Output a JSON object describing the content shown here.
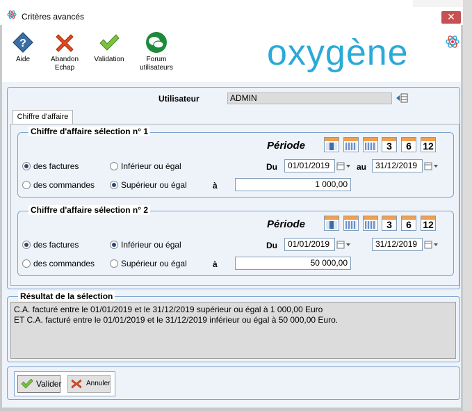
{
  "window": {
    "title": "Critères avancés",
    "close_glyph": "✕"
  },
  "toolbar": {
    "aide": "Aide",
    "abandon_1": "Abandon",
    "abandon_2": "Echap",
    "validation": "Validation",
    "forum_1": "Forum",
    "forum_2": "utilisateurs"
  },
  "logo": {
    "text": "oxygène"
  },
  "user": {
    "label": "Utilisateur",
    "value": "ADMIN"
  },
  "tab": {
    "label": "Chiffre d'affaire"
  },
  "selection1": {
    "title": "Chiffre d'affaire sélection n° 1",
    "periode": "Période",
    "cal_3": "3",
    "cal_6": "6",
    "cal_12": "12",
    "opt_factures": "des factures",
    "opt_commandes": "des commandes",
    "opt_inf": "Inférieur ou égal",
    "opt_sup": "Supérieur ou égal",
    "du_label": "Du",
    "au_label": "au",
    "a_label": "à",
    "date_from": "01/01/2019",
    "date_to": "31/12/2019",
    "amount": "1 000,00",
    "selected_type": "factures",
    "selected_compare": "sup"
  },
  "selection2": {
    "title": "Chiffre d'affaire sélection n° 2",
    "periode": "Période",
    "cal_3": "3",
    "cal_6": "6",
    "cal_12": "12",
    "opt_factures": "des factures",
    "opt_commandes": "des commandes",
    "opt_inf": "Inférieur ou égal",
    "opt_sup": "Supérieur ou égal",
    "du_label": "Du",
    "a_label": "à",
    "date_from": "01/01/2019",
    "date_to": "31/12/2019",
    "amount": "50 000,00",
    "selected_type": "factures",
    "selected_compare": "inf"
  },
  "result": {
    "title": "Résultat de la sélection",
    "line1": "C.A. facturé  entre le 01/01/2019 et le 31/12/2019 supérieur ou égal à 1 000,00 Euro",
    "line2": "ET C.A. facturé  entre le 01/01/2019 et le 31/12/2019 inférieur ou égal à 50 000,00 Euro."
  },
  "footer": {
    "valider": "Valider",
    "annuler": "Annuler"
  },
  "colors": {
    "accent": "#2aaad8",
    "group_border": "#7da2ce",
    "panel_bg": "#eef3fa",
    "close_red": "#c75050"
  }
}
